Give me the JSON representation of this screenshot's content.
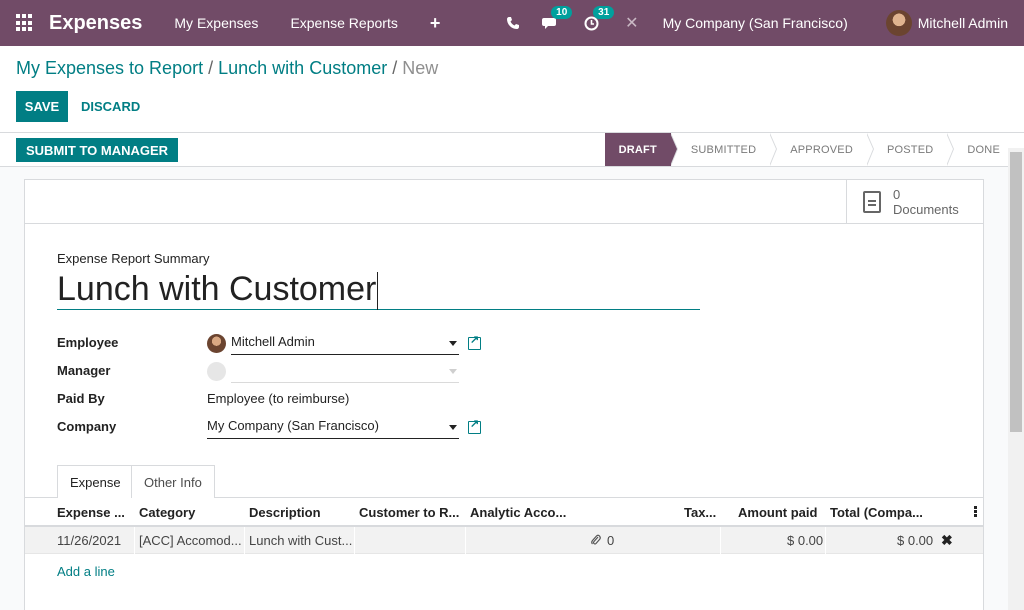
{
  "navbar": {
    "app_name": "Expenses",
    "menu": [
      "My Expenses",
      "Expense Reports",
      "+"
    ],
    "chat_badge": "10",
    "activity_badge": "31",
    "company": "My Company (San Francisco)",
    "user": "Mitchell Admin"
  },
  "breadcrumb": {
    "level1": "My Expenses to Report",
    "level2": "Lunch with Customer",
    "current": "New",
    "sep": "/"
  },
  "actions": {
    "save": "SAVE",
    "discard": "DISCARD",
    "submit": "SUBMIT TO MANAGER"
  },
  "stages": [
    "DRAFT",
    "SUBMITTED",
    "APPROVED",
    "POSTED",
    "DONE"
  ],
  "documents": {
    "count": "0",
    "label": "Documents"
  },
  "form": {
    "summary_label": "Expense Report Summary",
    "summary": "Lunch with Customer",
    "fields": {
      "employee_label": "Employee",
      "employee": "Mitchell Admin",
      "manager_label": "Manager",
      "manager": "",
      "paid_by_label": "Paid By",
      "paid_by": "Employee (to reimburse)",
      "company_label": "Company",
      "company": "My Company (San Francisco)"
    }
  },
  "tabs": [
    "Expense",
    "Other Info"
  ],
  "table": {
    "columns": [
      "Expense ...",
      "Category",
      "Description",
      "Customer to R...",
      "Analytic Acco...",
      "Tax...",
      "Amount paid",
      "Total (Compa..."
    ],
    "rows": [
      {
        "date": "11/26/2021",
        "category": "[ACC] Accomod...",
        "description": "Lunch with Cust...",
        "customer": "",
        "analytic": "",
        "attachments": "0",
        "tax": "",
        "amount_paid": "$ 0.00",
        "total": "$ 0.00"
      }
    ],
    "add_line": "Add a line"
  },
  "icons": [
    "apps-grid-icon",
    "phone-icon",
    "chat-icon",
    "activity-clock-icon",
    "debug-close-icon",
    "external-link-icon",
    "paperclip-icon",
    "document-icon",
    "delete-icon",
    "column-menu-icon"
  ],
  "colors": {
    "brand": "#714b67",
    "accent": "#017e84",
    "badge": "#00a09d"
  }
}
